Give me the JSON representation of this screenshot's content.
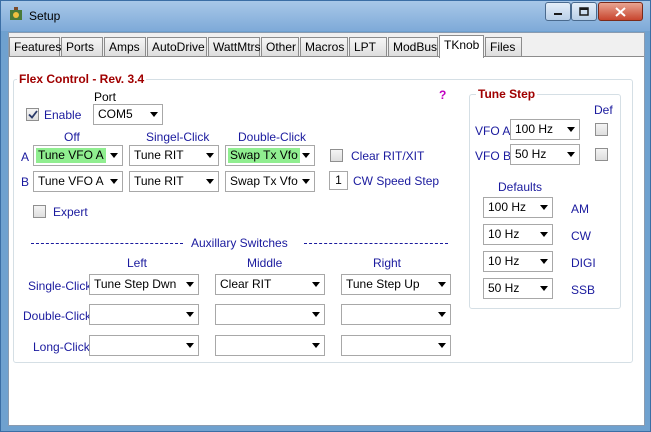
{
  "window": {
    "title": "Setup"
  },
  "tabs": [
    "Features",
    "Ports",
    "Amps",
    "AutoDrive",
    "WattMtrs",
    "Other",
    "Macros",
    "LPT",
    "ModBus",
    "TKnob",
    "Files"
  ],
  "active_tab": "TKnob",
  "flex": {
    "title": "Flex Control - Rev. 3.4",
    "help": "?",
    "port_label": "Port",
    "enable_label": "Enable",
    "enable_checked": true,
    "port_value": "COM5",
    "col_off": "Off",
    "col_single": "Singel-Click",
    "col_double": "Double-Click",
    "row_a": "A",
    "row_b": "B",
    "a_off": "Tune VFO A",
    "a_single": "Tune RIT",
    "a_double": "Swap Tx Vfo",
    "b_off": "Tune VFO A",
    "b_single": "Tune RIT",
    "b_double": "Swap Tx Vfo",
    "clear_rit_label": "Clear RIT/XIT",
    "clear_rit_checked": false,
    "cw_speed_value": "1",
    "cw_speed_label": "CW Speed Step",
    "expert_label": "Expert",
    "expert_checked": false
  },
  "aux": {
    "title": "Auxillary Switches",
    "col_left": "Left",
    "col_middle": "Middle",
    "col_right": "Right",
    "rows": [
      {
        "label": "Single-Click",
        "left": "Tune Step Dwn",
        "middle": "Clear RIT",
        "right": "Tune Step Up"
      },
      {
        "label": "Double-Click",
        "left": "",
        "middle": "",
        "right": ""
      },
      {
        "label": "Long-Click",
        "left": "",
        "middle": "",
        "right": ""
      }
    ]
  },
  "tune_step": {
    "title": "Tune Step",
    "def_label": "Def",
    "vfo_a_label": "VFO A",
    "vfo_a_value": "100 Hz",
    "vfo_b_label": "VFO B",
    "vfo_b_value": "50 Hz",
    "defaults_label": "Defaults",
    "defaults": [
      {
        "value": "100 Hz",
        "mode": "AM"
      },
      {
        "value": "10 Hz",
        "mode": "CW"
      },
      {
        "value": "10 Hz",
        "mode": "DIGI"
      },
      {
        "value": "50 Hz",
        "mode": "SSB"
      }
    ]
  },
  "colors": {
    "accent_red": "#a00000",
    "label_blue": "#1a1a9e",
    "highlight_green": "#90ee90",
    "help_magenta": "#c000c0"
  },
  "icons": [
    "app-icon",
    "minimize-icon",
    "maximize-icon",
    "close-icon",
    "chevron-down-icon",
    "checkmark-icon"
  ]
}
